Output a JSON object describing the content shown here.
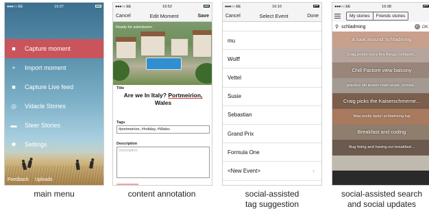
{
  "main_menu": {
    "status": {
      "carrier": "●●●○○ EE",
      "time": "16:37"
    },
    "items": [
      {
        "label": "Capture moment",
        "icon": "video-camera-icon",
        "active": true
      },
      {
        "label": "Import moment",
        "icon": "plus-icon",
        "active": false
      },
      {
        "label": "Capture Live feed",
        "icon": "video-camera-icon",
        "active": false
      },
      {
        "label": "Vidacle Stories",
        "icon": "target-icon",
        "active": false
      },
      {
        "label": "Steer Stories",
        "icon": "folder-icon",
        "active": false
      },
      {
        "label": "Settings",
        "icon": "gear-icon",
        "active": false
      }
    ],
    "footer": {
      "feedback": "Feedback",
      "uploads": "Uploads"
    },
    "caption": "main menu"
  },
  "content_annotation": {
    "status": {
      "carrier": "●●●○○ EE",
      "time": "16:52"
    },
    "nav": {
      "cancel": "Cancel",
      "title": "Edit Moment",
      "save": "Save"
    },
    "photo_overlay": "Ready for submission",
    "title_label": "Title",
    "title_value_prefix": "Are we In Italy? ",
    "title_value_underlined": "Portmeirion,",
    "title_value_suffix": "Wales",
    "tags_label": "Tags",
    "tags_value": "#portmeirion, #holiday, #Wales",
    "description_label": "Description",
    "description_placeholder": "Description",
    "caption": "content annotation"
  },
  "tag_suggestion": {
    "status": {
      "carrier": "●●●○○ EE",
      "time": "16:10"
    },
    "nav": {
      "cancel": "Cancel",
      "title": "Select Event",
      "done": "Done"
    },
    "partial_row": "",
    "events": [
      "mu",
      "Wolff",
      "Vettel",
      "Susie",
      "Sebastian",
      "Formula One",
      "Grand Prix",
      "<New Event>"
    ],
    "caption_line1": "social-assisted",
    "caption_line2": "tag suggestion"
  },
  "search_updates": {
    "status": {
      "carrier": "●●●○○ EE",
      "time": "16:38"
    },
    "segments": [
      "My stories",
      "Friends stories"
    ],
    "search_value": "schladming",
    "feed": [
      {
        "text": "A look around Schladming",
        "size": "big",
        "color": "#c9a08c"
      },
      {
        "text": "Craig points out a few things, schladm...",
        "size": "small",
        "color": "#b7a59d"
      },
      {
        "text": "Chill Factore view balcony",
        "size": "big",
        "color": "#9a857b"
      },
      {
        "text": "practice ski lesson main slope, schlad...",
        "size": "small",
        "color": "#a39a93"
      },
      {
        "text": "Craig picks the Kaiserschmerne...",
        "size": "big",
        "color": "#7b5e4c"
      },
      {
        "text": "Was pretty tasty! schladming tup",
        "size": "small",
        "color": "#a87a5e"
      },
      {
        "text": "Breakfast and coding",
        "size": "big",
        "color": "#8f7d6e"
      },
      {
        "text": "Bug fixing and having our breakfast...",
        "size": "small",
        "color": "#6b5a4d"
      },
      {
        "text": "",
        "size": "small",
        "color": "#c0b9ad"
      }
    ],
    "caption_line1": "social-assisted search",
    "caption_line2": "and social updates"
  }
}
